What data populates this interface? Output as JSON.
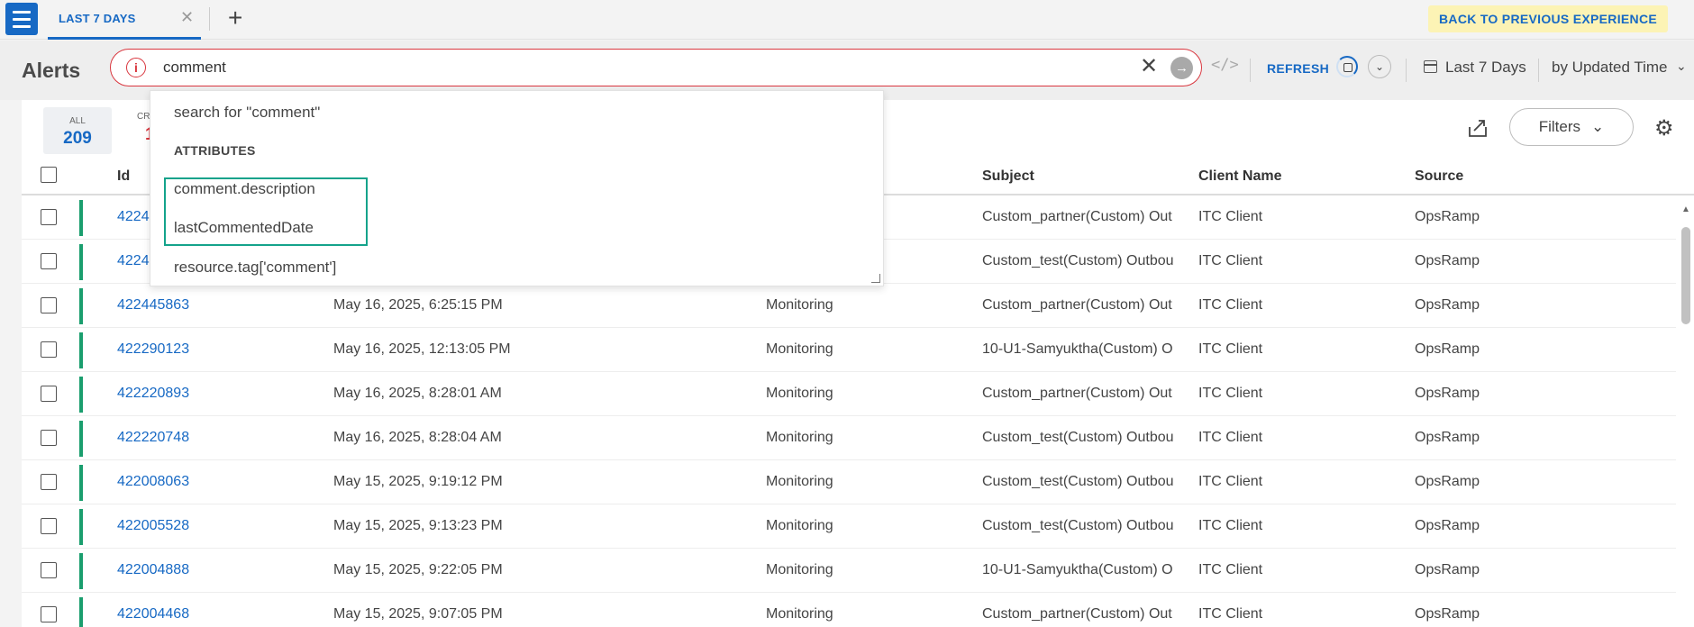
{
  "tabs": {
    "active_label": "LAST 7 DAYS",
    "close": "✕",
    "add": "+"
  },
  "back_button": "BACK TO PREVIOUS EXPERIENCE",
  "header": {
    "title": "Alerts",
    "search_value": "comment",
    "error_glyph": "i",
    "clear_glyph": "✕",
    "go_glyph": "→",
    "code_glyph": "</>",
    "refresh_label": "REFRESH",
    "chevron_glyph": "⌄",
    "period_label": "Last 7 Days",
    "sort_label": "by Updated Time"
  },
  "summary": {
    "all_label": "ALL",
    "all_count": "209",
    "critical_label": "CRI",
    "critical_count": "1"
  },
  "toolbar": {
    "filters_label": "Filters",
    "filters_chevron": "⌄",
    "gear_glyph": "⚙"
  },
  "table": {
    "columns": {
      "id": "Id",
      "subject": "Subject",
      "client": "Client Name",
      "source": "Source"
    },
    "rows": [
      {
        "id": "4224",
        "updated": "",
        "type": "",
        "subject": "Custom_partner(Custom) Out",
        "client": "ITC Client",
        "source": "OpsRamp"
      },
      {
        "id": "4224",
        "updated": "",
        "type": "",
        "subject": "Custom_test(Custom) Outbou",
        "client": "ITC Client",
        "source": "OpsRamp"
      },
      {
        "id": "422445863",
        "updated": "May 16, 2025, 6:25:15 PM",
        "type": "Monitoring",
        "subject": "Custom_partner(Custom) Out",
        "client": "ITC Client",
        "source": "OpsRamp"
      },
      {
        "id": "422290123",
        "updated": "May 16, 2025, 12:13:05 PM",
        "type": "Monitoring",
        "subject": "10-U1-Samyuktha(Custom) O",
        "client": "ITC Client",
        "source": "OpsRamp"
      },
      {
        "id": "422220893",
        "updated": "May 16, 2025, 8:28:01 AM",
        "type": "Monitoring",
        "subject": "Custom_partner(Custom) Out",
        "client": "ITC Client",
        "source": "OpsRamp"
      },
      {
        "id": "422220748",
        "updated": "May 16, 2025, 8:28:04 AM",
        "type": "Monitoring",
        "subject": "Custom_test(Custom) Outbou",
        "client": "ITC Client",
        "source": "OpsRamp"
      },
      {
        "id": "422008063",
        "updated": "May 15, 2025, 9:19:12 PM",
        "type": "Monitoring",
        "subject": "Custom_test(Custom) Outbou",
        "client": "ITC Client",
        "source": "OpsRamp"
      },
      {
        "id": "422005528",
        "updated": "May 15, 2025, 9:13:23 PM",
        "type": "Monitoring",
        "subject": "Custom_test(Custom) Outbou",
        "client": "ITC Client",
        "source": "OpsRamp"
      },
      {
        "id": "422004888",
        "updated": "May 15, 2025, 9:22:05 PM",
        "type": "Monitoring",
        "subject": "10-U1-Samyuktha(Custom) O",
        "client": "ITC Client",
        "source": "OpsRamp"
      },
      {
        "id": "422004468",
        "updated": "May 15, 2025, 9:07:05 PM",
        "type": "Monitoring",
        "subject": "Custom_partner(Custom) Out",
        "client": "ITC Client",
        "source": "OpsRamp"
      }
    ]
  },
  "dropdown": {
    "search_for": "search for \"comment\"",
    "attributes_heading": "ATTRIBUTES",
    "attributes": [
      "comment.description",
      "lastCommentedDate",
      "resource.tag['comment']"
    ]
  },
  "colors": {
    "accent": "#1769c4",
    "error": "#d9363e",
    "status_bar": "#1a9e6e",
    "highlight": "#14a38b",
    "banner": "#fcf3b5"
  }
}
